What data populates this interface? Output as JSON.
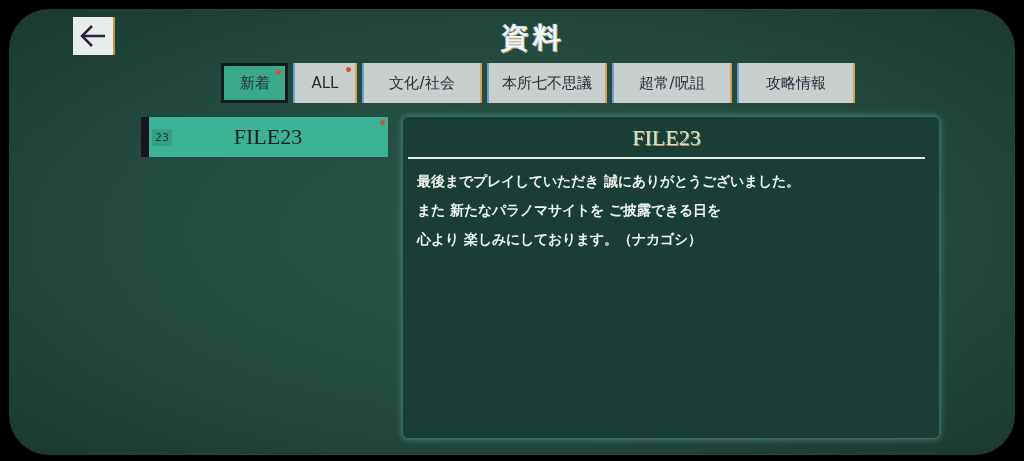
{
  "title": "資料",
  "tabs": [
    {
      "label": "新着",
      "selected": true,
      "new": true
    },
    {
      "label": "ALL",
      "selected": false,
      "new": true
    },
    {
      "label": "文化/社会",
      "selected": false,
      "new": false
    },
    {
      "label": "本所七不思議",
      "selected": false,
      "new": false
    },
    {
      "label": "超常/呪詛",
      "selected": false,
      "new": false
    },
    {
      "label": "攻略情報",
      "selected": false,
      "new": false
    }
  ],
  "files": [
    {
      "number": "23",
      "name": "FILE23",
      "selected": true,
      "new": true
    }
  ],
  "detail": {
    "title": "FILE23",
    "lines": [
      "最後までプレイしていただき 誠にありがとうございました。",
      "また 新たなパラノマサイトを ご披露できる日を",
      "心より 楽しみにしております。（ナカゴシ）"
    ]
  }
}
